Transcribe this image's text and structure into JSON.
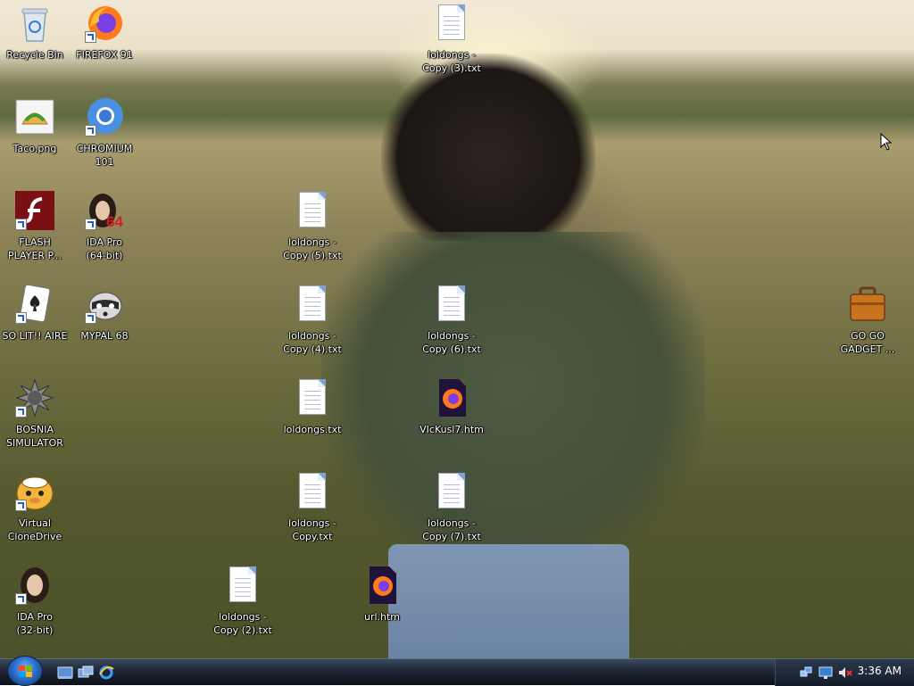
{
  "desktop": {
    "icons": [
      {
        "label": "Recycle Bin",
        "icon": "recycle-bin-icon"
      },
      {
        "label": "FIREFOX 91",
        "icon": "firefox-icon"
      },
      {
        "label": "loldongs -\nCopy (3).txt",
        "icon": "text-file-icon"
      },
      {
        "label": "Taco.png",
        "icon": "taco-image-icon"
      },
      {
        "label": "CHROMIUM\n101",
        "icon": "chromium-icon"
      },
      {
        "label": "FLASH\nPLAYER P...",
        "icon": "flash-player-icon"
      },
      {
        "label": "IDA Pro\n(64-bit)",
        "icon": "ida-pro-icon"
      },
      {
        "label": "loldongs -\nCopy (5).txt",
        "icon": "text-file-icon"
      },
      {
        "label": "SO LIT!! AIRE",
        "icon": "solitaire-icon"
      },
      {
        "label": "MYPAL 68",
        "icon": "mypal-icon"
      },
      {
        "label": "loldongs -\nCopy (4).txt",
        "icon": "text-file-icon"
      },
      {
        "label": "loldongs -\nCopy (6).txt",
        "icon": "text-file-icon"
      },
      {
        "label": "GO GO\nGADGET ...",
        "icon": "briefcase-icon"
      },
      {
        "label": "BOSNIA\nSIMULATOR",
        "icon": "bosnia-simulator-icon"
      },
      {
        "label": "loldongs.txt",
        "icon": "text-file-icon"
      },
      {
        "label": "VIcKusl7.htm",
        "icon": "firefox-html-icon"
      },
      {
        "label": "Virtual\nCloneDrive",
        "icon": "virtual-clonedrive-icon"
      },
      {
        "label": "loldongs -\nCopy.txt",
        "icon": "text-file-icon"
      },
      {
        "label": "loldongs -\nCopy (7).txt",
        "icon": "text-file-icon"
      },
      {
        "label": "IDA Pro\n(32-bit)",
        "icon": "ida-pro-icon"
      },
      {
        "label": "loldongs -\nCopy (2).txt",
        "icon": "text-file-icon"
      },
      {
        "label": "url.htm",
        "icon": "firefox-html-icon"
      }
    ]
  },
  "taskbar": {
    "start_button": "windows-start-orb-icon",
    "quick_launch": [
      "show-desktop-icon",
      "switch-windows-icon",
      "internet-explorer-icon"
    ],
    "tray_icons": [
      "network-icon",
      "display-icon",
      "speaker-muted-icon"
    ],
    "clock": "3:36 AM"
  },
  "colors": {
    "taskbar": "#1d2634",
    "label_text": "#ffffff"
  }
}
